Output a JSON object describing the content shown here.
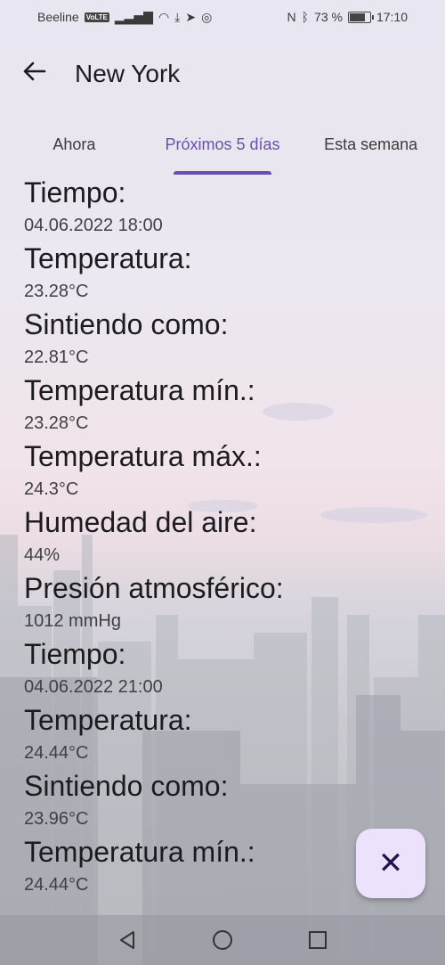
{
  "status_bar": {
    "carrier": "Beeline",
    "volte": "VoLTE",
    "battery": "73 %",
    "time": "17:10"
  },
  "app_bar": {
    "title": "New York"
  },
  "tabs": [
    {
      "label": "Ahora",
      "active": false
    },
    {
      "label": "Próximos 5 días",
      "active": true
    },
    {
      "label": "Esta semana",
      "active": false
    }
  ],
  "forecast": [
    {
      "label": "Tiempo:",
      "value": "04.06.2022 18:00"
    },
    {
      "label": "Temperatura:",
      "value": "23.28°C"
    },
    {
      "label": "Sintiendo como:",
      "value": "22.81°C"
    },
    {
      "label": "Temperatura mín.:",
      "value": "23.28°C"
    },
    {
      "label": "Temperatura máx.:",
      "value": "24.3°C"
    },
    {
      "label": "Humedad del aire:",
      "value": "44%"
    },
    {
      "label": "Presión atmosférico:",
      "value": "1012 mmHg"
    },
    {
      "label": "Tiempo:",
      "value": "04.06.2022 21:00"
    },
    {
      "label": "Temperatura:",
      "value": "24.44°C"
    },
    {
      "label": "Sintiendo como:",
      "value": "23.96°C"
    },
    {
      "label": "Temperatura mín.:",
      "value": "24.44°C"
    }
  ],
  "colors": {
    "accent": "#6a4fb3",
    "fab_bg": "#ece2fb",
    "fab_icon": "#23134f"
  },
  "icons": {
    "back": "arrow-left-icon",
    "fab": "close-icon",
    "nav": [
      "nav-back-icon",
      "nav-home-icon",
      "nav-recents-icon"
    ]
  }
}
